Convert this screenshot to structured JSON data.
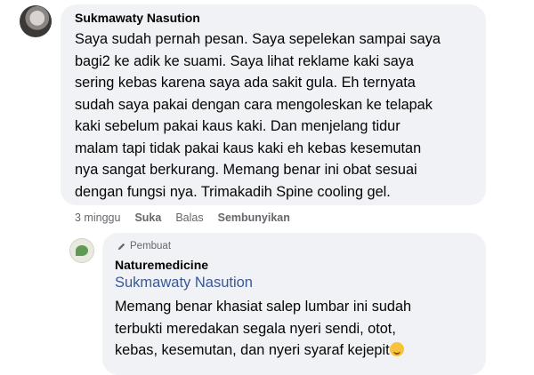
{
  "comment": {
    "author": "Sukmawaty Nasution",
    "text": "Saya sudah pernah pesan. Saya sepelekan sampai saya\nbagi2 ke adik ke suami. Saya lihat reklame kaki saya\nsering kebas karena saya ada sakit gula. Eh ternyata\nsudah saya pakai dengan cara mengoleskan ke telapak\nkaki sebelum pakai kaus kaki. Dan menjelang tidur\nmalam tapi tidak pakai kaus kaki eh kebas kesemutan\nnya sangat berkurang. Memang benar ini obat sesuai\ndengan fungsi nya. Trimakadih Spine cooling gel.",
    "time": "3 minggu",
    "like_label": "Suka",
    "reply_label": "Balas",
    "hide_label": "Sembunyikan"
  },
  "reply": {
    "badge_icon": "pencil-icon",
    "badge": "Pembuat",
    "author": "Naturemedicine",
    "mention": "Sukmawaty Nasution",
    "text": "Memang benar khasiat salep lumbar ini sudah\nterbukti meredakan segala nyeri sendi, otot,\nkebas, kesemutan, dan nyeri syaraf kejepit",
    "emoji": "smiling-face-emoji"
  },
  "colors": {
    "bubble": "#f0f2f5",
    "link": "#385898",
    "meta": "#65676b"
  }
}
